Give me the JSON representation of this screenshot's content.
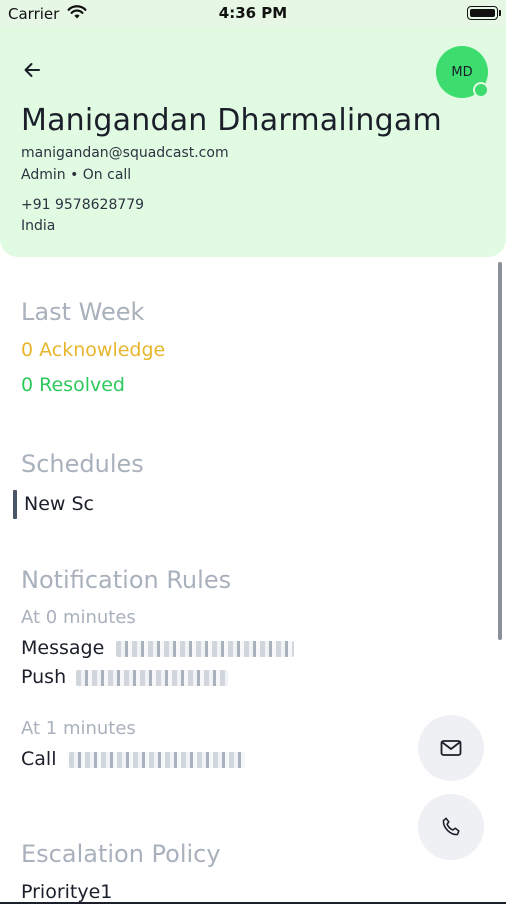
{
  "status_bar": {
    "carrier": "Carrier",
    "time": "4:36 PM"
  },
  "profile": {
    "initials": "MD",
    "name": "Manigandan Dharmalingam",
    "email": "manigandan@squadcast.com",
    "role_status": "Admin • On call",
    "phone": "+91 9578628779",
    "country": "India"
  },
  "last_week": {
    "title": "Last Week",
    "acknowledged": "0 Acknowledge",
    "resolved": "0 Resolved"
  },
  "schedules": {
    "title": "Schedules",
    "items": [
      "New Sc"
    ]
  },
  "notification_rules": {
    "title": "Notification Rules",
    "groups": [
      {
        "heading": "At 0 minutes",
        "rules": [
          {
            "label": "Message"
          },
          {
            "label": "Push"
          }
        ]
      },
      {
        "heading": "At 1 minutes",
        "rules": [
          {
            "label": "Call"
          }
        ]
      }
    ]
  },
  "escalation_policy": {
    "title": "Escalation Policy",
    "name": "Prioritye1"
  },
  "icons": {
    "back": "arrow-left-icon",
    "email": "mail-icon",
    "call": "phone-icon"
  },
  "colors": {
    "header_bg": "#e1fbe3",
    "avatar": "#3ddc6f",
    "acknowledge": "#e8b62c",
    "resolved": "#2ec95c",
    "section_title": "#a9b1bd"
  }
}
